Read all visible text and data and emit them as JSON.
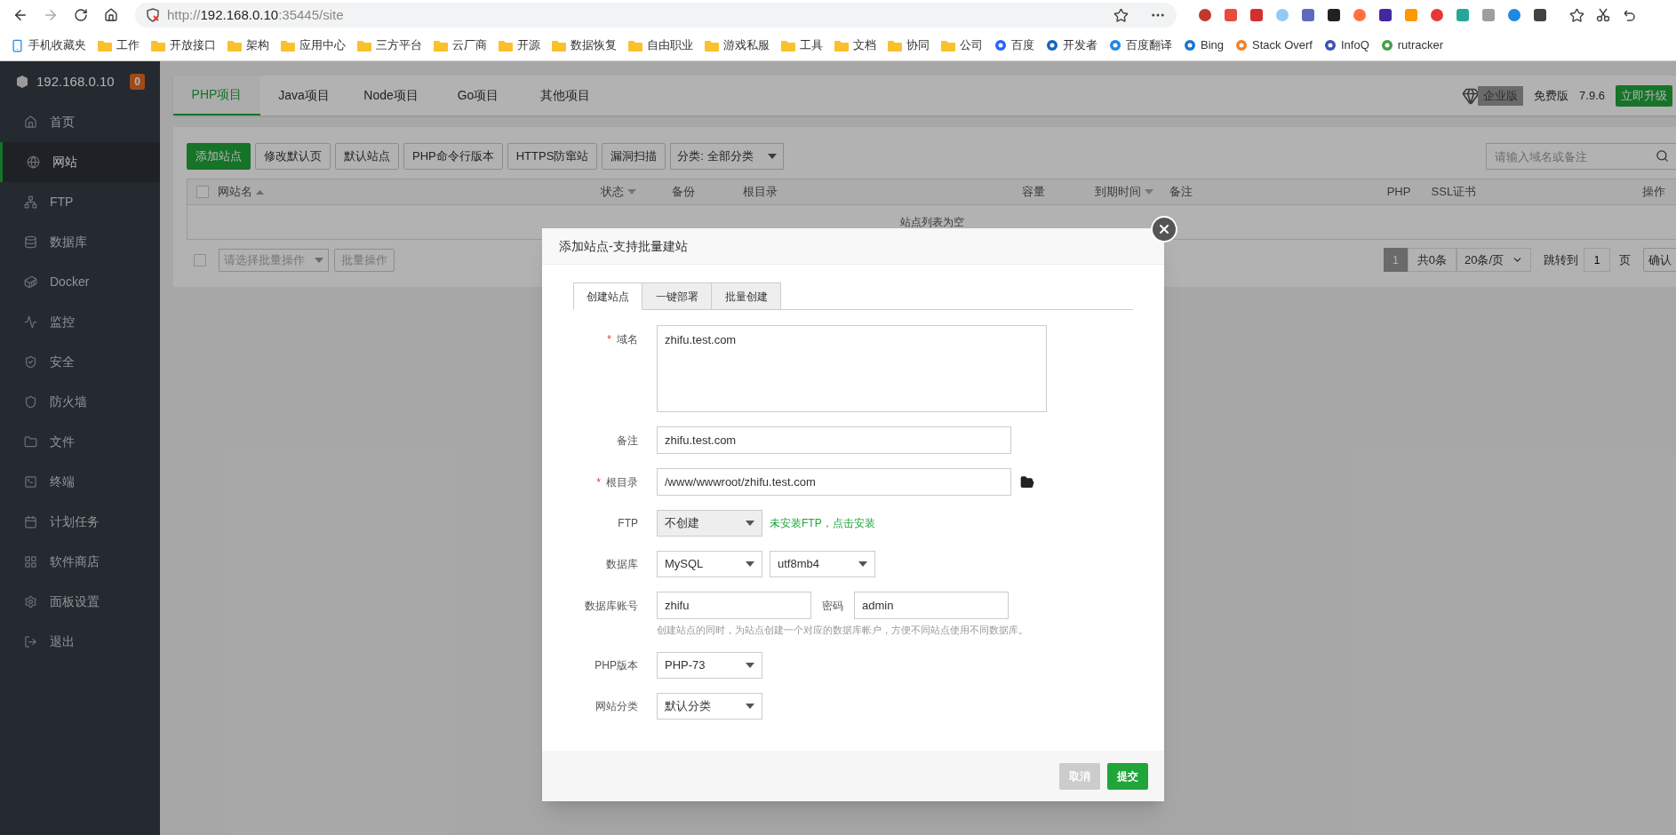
{
  "browser": {
    "url": {
      "scheme": "http://",
      "host": "192.168.0.10",
      "rest": ":35445/site"
    },
    "bookmarks": [
      {
        "kind": "mobile",
        "label": "手机收藏夹"
      },
      {
        "kind": "folder",
        "label": "工作"
      },
      {
        "kind": "folder",
        "label": "开放接口"
      },
      {
        "kind": "folder",
        "label": "架构"
      },
      {
        "kind": "folder",
        "label": "应用中心"
      },
      {
        "kind": "folder",
        "label": "三方平台"
      },
      {
        "kind": "folder",
        "label": "云厂商"
      },
      {
        "kind": "folder",
        "label": "开源"
      },
      {
        "kind": "folder",
        "label": "数据恢复"
      },
      {
        "kind": "folder",
        "label": "自由职业"
      },
      {
        "kind": "folder",
        "label": "游戏私服"
      },
      {
        "kind": "folder",
        "label": "工具"
      },
      {
        "kind": "folder",
        "label": "文档"
      },
      {
        "kind": "folder",
        "label": "协同"
      },
      {
        "kind": "folder",
        "label": "公司"
      },
      {
        "kind": "site",
        "label": "百度"
      },
      {
        "kind": "site",
        "label": "开发者"
      },
      {
        "kind": "site",
        "label": "百度翻译"
      },
      {
        "kind": "site",
        "label": "Bing"
      },
      {
        "kind": "site",
        "label": "Stack Overf"
      },
      {
        "kind": "site",
        "label": "InfoQ"
      },
      {
        "kind": "site",
        "label": "rutracker"
      }
    ]
  },
  "sidebar": {
    "server": "192.168.0.10",
    "badge": "0",
    "items": [
      {
        "label": "首页",
        "selected": false
      },
      {
        "label": "网站",
        "selected": true
      },
      {
        "label": "FTP",
        "selected": false
      },
      {
        "label": "数据库",
        "selected": false
      },
      {
        "label": "Docker",
        "selected": false
      },
      {
        "label": "监控",
        "selected": false
      },
      {
        "label": "安全",
        "selected": false
      },
      {
        "label": "防火墙",
        "selected": false
      },
      {
        "label": "文件",
        "selected": false
      },
      {
        "label": "终端",
        "selected": false
      },
      {
        "label": "计划任务",
        "selected": false
      },
      {
        "label": "软件商店",
        "selected": false
      },
      {
        "label": "面板设置",
        "selected": false
      },
      {
        "label": "退出",
        "selected": false
      }
    ]
  },
  "tabs": [
    {
      "label": "PHP项目",
      "selected": true
    },
    {
      "label": "Java项目",
      "selected": false
    },
    {
      "label": "Node项目",
      "selected": false
    },
    {
      "label": "Go项目",
      "selected": false
    },
    {
      "label": "其他项目",
      "selected": false
    }
  ],
  "edition": {
    "enterprise": "企业版",
    "free": "免费版",
    "version": "7.9.6",
    "upgrade": "立即升级"
  },
  "toolbar": {
    "buttons": [
      {
        "label": "添加站点",
        "kind": "primary"
      },
      {
        "label": "修改默认页",
        "kind": "default"
      },
      {
        "label": "默认站点",
        "kind": "default"
      },
      {
        "label": "PHP命令行版本",
        "kind": "default"
      },
      {
        "label": "HTTPS防窜站",
        "kind": "default"
      },
      {
        "label": "漏洞扫描",
        "kind": "default"
      }
    ],
    "category": "分类: 全部分类",
    "search_placeholder": "请输入域名或备注"
  },
  "table": {
    "columns": [
      {
        "label": "网站名",
        "sortable": true
      },
      {
        "label": "状态",
        "sortable": true
      },
      {
        "label": "备份",
        "sortable": false
      },
      {
        "label": "根目录",
        "sortable": false
      },
      {
        "label": "容量",
        "sortable": false
      },
      {
        "label": "到期时间",
        "sortable": true
      },
      {
        "label": "备注",
        "sortable": false
      },
      {
        "label": "PHP",
        "sortable": false
      },
      {
        "label": "SSL证书",
        "sortable": false
      },
      {
        "label": "操作",
        "sortable": false
      }
    ],
    "select_all_checked": false,
    "batch_checked": false,
    "empty": "站点列表为空",
    "batch_placeholder": "请选择批量操作",
    "batch_button": "批量操作"
  },
  "pagination": {
    "page": "1",
    "total": "共0条",
    "per_page": "20条/页",
    "jump_label": "跳转到",
    "jump_value": "1",
    "page_unit": "页",
    "confirm": "确认"
  },
  "dialog": {
    "title": "添加站点-支持批量建站",
    "tabs": [
      {
        "label": "创建站点",
        "selected": true
      },
      {
        "label": "一键部署",
        "selected": false
      },
      {
        "label": "批量创建",
        "selected": false
      }
    ],
    "rows": [
      {
        "kind": "textarea",
        "label": "域名",
        "marker": "*",
        "value": "zhifu.test.com"
      },
      {
        "kind": "input",
        "label": "备注",
        "value": "zhifu.test.com"
      },
      {
        "kind": "path",
        "label": "根目录",
        "marker": "*",
        "value": "/www/wwwroot/zhifu.test.com"
      },
      {
        "kind": "select",
        "label": "FTP",
        "value": "不创建",
        "disabled": true,
        "link": "未安装FTP，点击安装"
      },
      {
        "kind": "select_pair",
        "label": "数据库",
        "values": [
          "MySQL",
          "utf8mb4"
        ]
      },
      {
        "kind": "account",
        "label": "数据库账号",
        "value": "zhifu",
        "second_label": "密码",
        "second_value": "admin",
        "hint": "创建站点的同时，为站点创建一个对应的数据库帐户，方便不同站点使用不同数据库。"
      },
      {
        "kind": "select",
        "label": "PHP版本",
        "value": "PHP-73",
        "disabled": false
      },
      {
        "kind": "select",
        "label": "网站分类",
        "value": "默认分类",
        "disabled": false
      }
    ],
    "buttons": [
      {
        "label": "取消",
        "kind": "secondary"
      },
      {
        "label": "提交",
        "kind": "primary"
      }
    ]
  }
}
